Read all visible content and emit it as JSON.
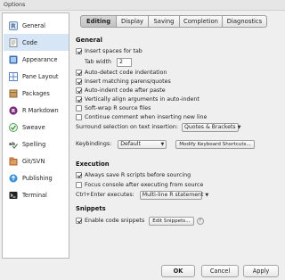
{
  "window": {
    "title": "Options"
  },
  "sidebar": {
    "items": [
      {
        "label": "General",
        "icon": "r-general-icon",
        "color": "#6b8fb8"
      },
      {
        "label": "Code",
        "icon": "code-icon",
        "color": "#7f7f7f",
        "selected": true
      },
      {
        "label": "Appearance",
        "icon": "appearance-icon",
        "color": "#3e6fb0"
      },
      {
        "label": "Pane Layout",
        "icon": "pane-layout-icon",
        "color": "#5b88c6"
      },
      {
        "label": "Packages",
        "icon": "packages-icon",
        "color": "#8a6a3c"
      },
      {
        "label": "R Markdown",
        "icon": "r-markdown-icon",
        "color": "#7a2a7a"
      },
      {
        "label": "Sweave",
        "icon": "sweave-icon",
        "color": "#5aa55a"
      },
      {
        "label": "Spelling",
        "icon": "spelling-icon",
        "color": "#4b7f4b"
      },
      {
        "label": "Git/SVN",
        "icon": "git-svn-icon",
        "color": "#b85a2a"
      },
      {
        "label": "Publishing",
        "icon": "publishing-icon",
        "color": "#3b8fd6"
      },
      {
        "label": "Terminal",
        "icon": "terminal-icon",
        "color": "#222222"
      }
    ]
  },
  "tabs": [
    {
      "label": "Editing",
      "active": true
    },
    {
      "label": "Display"
    },
    {
      "label": "Saving"
    },
    {
      "label": "Completion"
    },
    {
      "label": "Diagnostics"
    }
  ],
  "general": {
    "title": "General",
    "insert_spaces": "Insert spaces for tab",
    "tab_width_label": "Tab width",
    "tab_width_value": "2",
    "auto_detect": "Auto-detect code indentation",
    "insert_matching": "Insert matching parens/quotes",
    "auto_indent": "Auto-indent code after paste",
    "vertically_align": "Vertically align arguments in auto-indent",
    "soft_wrap": "Soft-wrap R source files",
    "continue_comment": "Continue comment when inserting new line",
    "surround_label": "Surround selection on text insertion:",
    "surround_value": "Quotes & Brackets",
    "keybindings_label": "Keybindings:",
    "keybindings_value": "Default",
    "modify_shortcuts": "Modify Keyboard Shortcuts..."
  },
  "execution": {
    "title": "Execution",
    "always_save": "Always save R scripts before sourcing",
    "focus_console": "Focus console after executing from source",
    "ctrl_enter_label": "Ctrl+Enter executes:",
    "ctrl_enter_value": "Multi-line R statement"
  },
  "snippets": {
    "title": "Snippets",
    "enable": "Enable code snippets",
    "edit": "Edit Snippets...",
    "help": "?"
  },
  "buttons": {
    "ok": "OK",
    "cancel": "Cancel",
    "apply": "Apply"
  }
}
